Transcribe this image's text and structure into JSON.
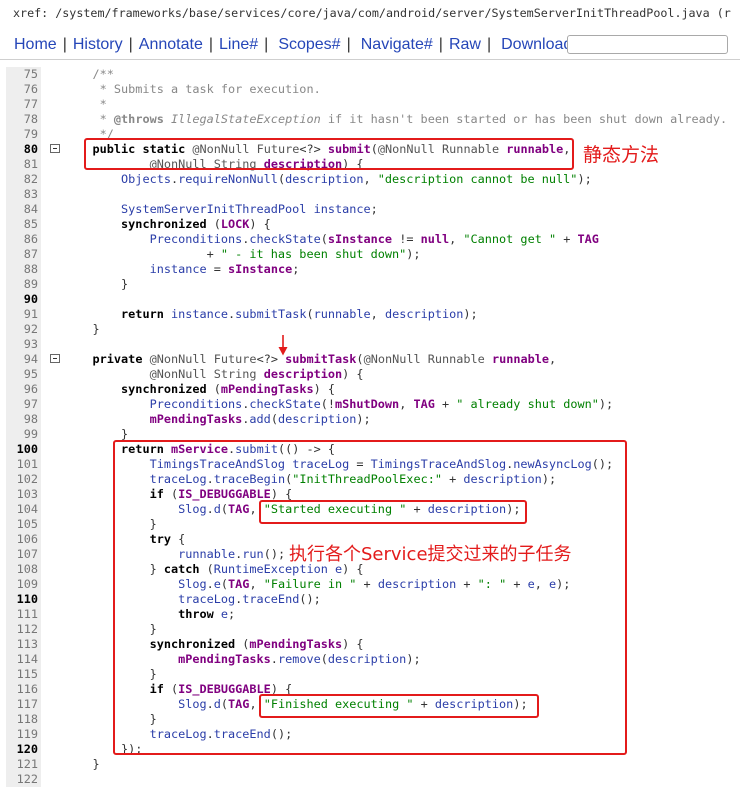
{
  "header": {
    "xref_label": "xref:",
    "path": "/system/frameworks/base/services/core/java/com/android/server/SystemServerInitThreadPool.java",
    "revision_fragment": "(r"
  },
  "nav": {
    "items": [
      {
        "label": "Home"
      },
      {
        "label": "History"
      },
      {
        "label": "Annotate"
      },
      {
        "label": "Line#"
      },
      {
        "label": "Scopes#"
      },
      {
        "label": "Navigate#"
      },
      {
        "label": "Raw"
      },
      {
        "label": "Download"
      }
    ],
    "separator": "|"
  },
  "colors": {
    "link": "#2546b8",
    "annotation": "#e31b1b",
    "string": "#008000",
    "comment": "#888888",
    "field": "#800080",
    "reference": "#2a3da8",
    "gutter": "#eeeeee"
  },
  "code": {
    "lines": [
      {
        "number": 75,
        "text": "    /**"
      },
      {
        "number": 76,
        "text": "     * Submits a task for execution."
      },
      {
        "number": 77,
        "text": "     *"
      },
      {
        "number": 78,
        "text": "     * @throws IllegalStateException if it hasn't been started or has been shut down already."
      },
      {
        "number": 79,
        "text": "     */"
      },
      {
        "number": 80,
        "text": "    public static @NonNull Future<?> submit(@NonNull Runnable runnable,",
        "fold_icon": "collapse-icon"
      },
      {
        "number": 81,
        "text": "            @NonNull String description) {"
      },
      {
        "number": 82,
        "text": "        Objects.requireNonNull(description, \"description cannot be null\");"
      },
      {
        "number": 83,
        "text": ""
      },
      {
        "number": 84,
        "text": "        SystemServerInitThreadPool instance;"
      },
      {
        "number": 85,
        "text": "        synchronized (LOCK) {"
      },
      {
        "number": 86,
        "text": "            Preconditions.checkState(sInstance != null, \"Cannot get \" + TAG"
      },
      {
        "number": 87,
        "text": "                    + \" - it has been shut down\");"
      },
      {
        "number": 88,
        "text": "            instance = sInstance;"
      },
      {
        "number": 89,
        "text": "        }"
      },
      {
        "number": 90,
        "text": ""
      },
      {
        "number": 91,
        "text": "        return instance.submitTask(runnable, description);"
      },
      {
        "number": 92,
        "text": "    }"
      },
      {
        "number": 93,
        "text": ""
      },
      {
        "number": 94,
        "text": "    private @NonNull Future<?> submitTask(@NonNull Runnable runnable,",
        "fold_icon": "collapse-icon"
      },
      {
        "number": 95,
        "text": "            @NonNull String description) {"
      },
      {
        "number": 96,
        "text": "        synchronized (mPendingTasks) {"
      },
      {
        "number": 97,
        "text": "            Preconditions.checkState(!mShutDown, TAG + \" already shut down\");"
      },
      {
        "number": 98,
        "text": "            mPendingTasks.add(description);"
      },
      {
        "number": 99,
        "text": "        }"
      },
      {
        "number": 100,
        "text": "        return mService.submit(() -> {"
      },
      {
        "number": 101,
        "text": "            TimingsTraceAndSlog traceLog = TimingsTraceAndSlog.newAsyncLog();"
      },
      {
        "number": 102,
        "text": "            traceLog.traceBegin(\"InitThreadPoolExec:\" + description);"
      },
      {
        "number": 103,
        "text": "            if (IS_DEBUGGABLE) {"
      },
      {
        "number": 104,
        "text": "                Slog.d(TAG, \"Started executing \" + description);"
      },
      {
        "number": 105,
        "text": "            }"
      },
      {
        "number": 106,
        "text": "            try {"
      },
      {
        "number": 107,
        "text": "                runnable.run();"
      },
      {
        "number": 108,
        "text": "            } catch (RuntimeException e) {"
      },
      {
        "number": 109,
        "text": "                Slog.e(TAG, \"Failure in \" + description + \": \" + e, e);"
      },
      {
        "number": 110,
        "text": "                traceLog.traceEnd();"
      },
      {
        "number": 111,
        "text": "                throw e;"
      },
      {
        "number": 112,
        "text": "            }"
      },
      {
        "number": 113,
        "text": "            synchronized (mPendingTasks) {"
      },
      {
        "number": 114,
        "text": "                mPendingTasks.remove(description);"
      },
      {
        "number": 115,
        "text": "            }"
      },
      {
        "number": 116,
        "text": "            if (IS_DEBUGGABLE) {"
      },
      {
        "number": 117,
        "text": "                Slog.d(TAG, \"Finished executing \" + description);"
      },
      {
        "number": 118,
        "text": "            }"
      },
      {
        "number": 119,
        "text": "            traceLog.traceEnd();"
      },
      {
        "number": 120,
        "text": "        });"
      },
      {
        "number": 121,
        "text": "    }"
      },
      {
        "number": 122,
        "text": ""
      }
    ]
  },
  "annotations": {
    "static_method_note": "静态方法",
    "subtask_note": "执行各个Service提交过来的子任务"
  }
}
